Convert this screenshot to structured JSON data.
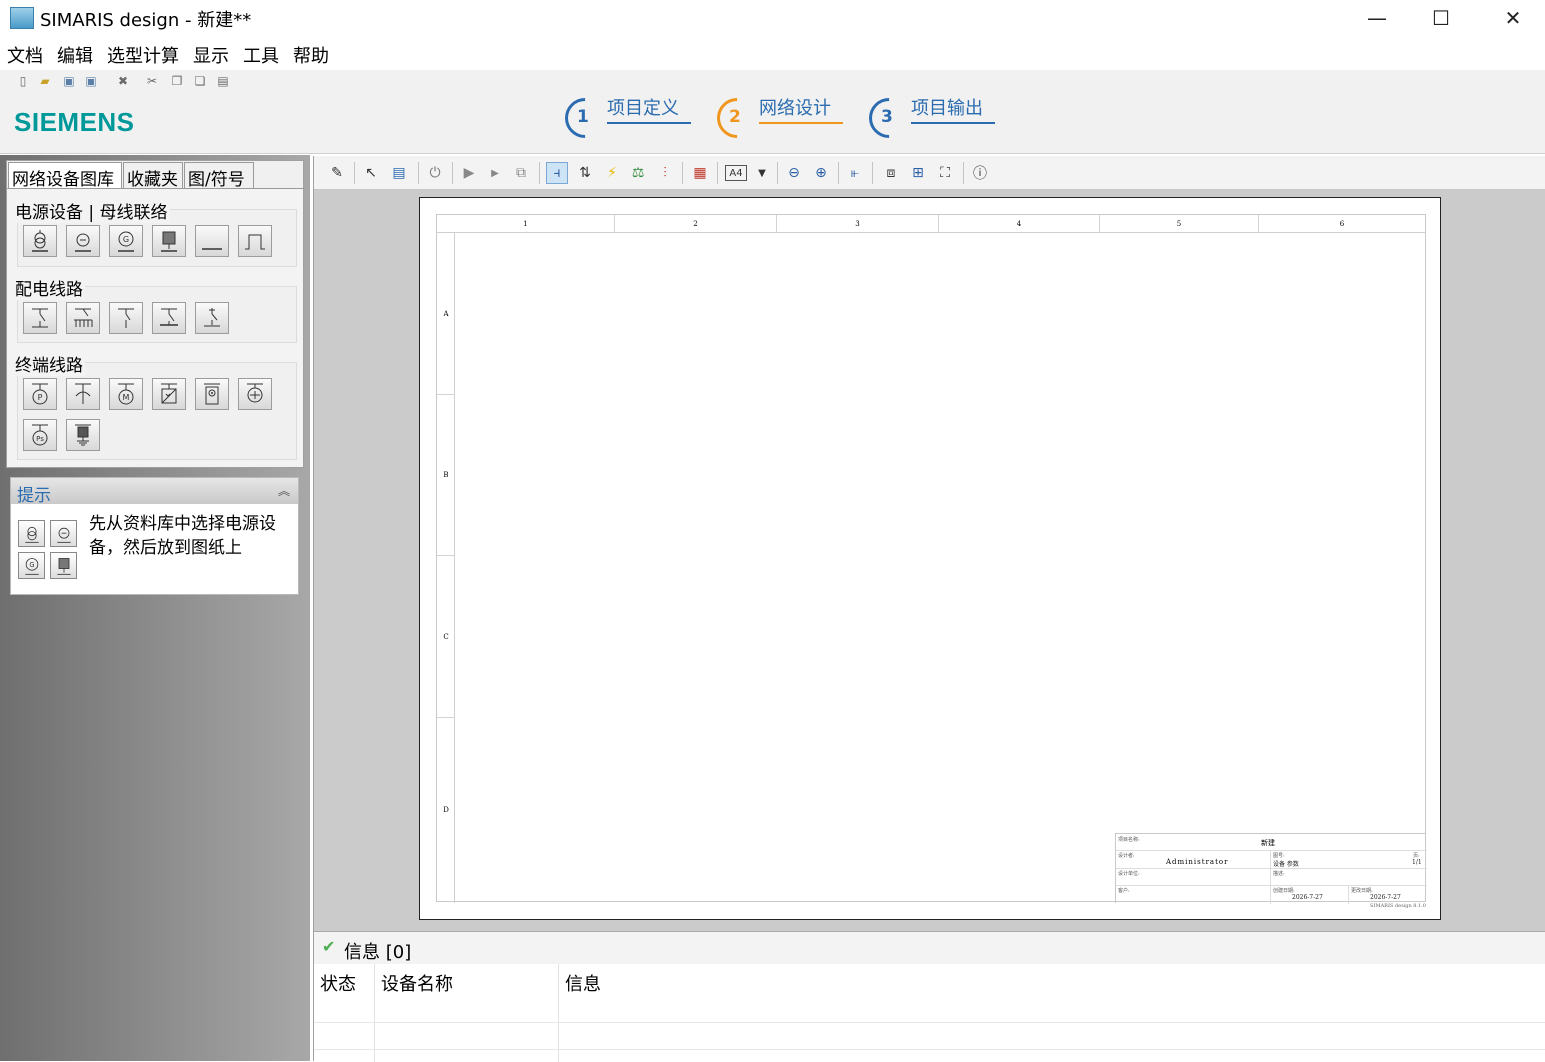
{
  "window": {
    "title": "SIMARIS design - 新建**",
    "minimize": "—",
    "maximize": "☐",
    "close": "✕"
  },
  "menu": [
    "文档",
    "编辑",
    "选型计算",
    "显示",
    "工具",
    "帮助"
  ],
  "brand": "SIEMENS",
  "steps": [
    {
      "num": "1",
      "label": "项目定义",
      "active": false
    },
    {
      "num": "2",
      "label": "网络设计",
      "active": true
    },
    {
      "num": "3",
      "label": "项目输出",
      "active": false
    }
  ],
  "library": {
    "tabs": [
      "网络设备图库",
      "收藏夹",
      "图/符号"
    ],
    "groups": [
      {
        "title": "电源设备 | 母线联络",
        "symbols": [
          "transformer-icon",
          "transformer-alt-icon",
          "generator-icon",
          "ups-icon",
          "busbar-icon",
          "coupler-icon"
        ]
      },
      {
        "title": "配电线路",
        "symbols": [
          "distribution-icon",
          "busway-icon",
          "cable-feeder-icon",
          "sub-distribution-icon",
          "switch-feeder-icon"
        ]
      },
      {
        "title": "终端线路",
        "symbols": [
          "load-p-icon",
          "load-icon",
          "motor-icon",
          "capacitor-icon",
          "charger-icon",
          "equipment-icon",
          "load-ps-icon",
          "ground-load-icon"
        ]
      }
    ]
  },
  "hint": {
    "title": "提示",
    "text": "先从资料库中选择电源设备，然后放到图纸上"
  },
  "drawing": {
    "columns": [
      "1",
      "2",
      "3",
      "4",
      "5",
      "6"
    ],
    "rows": [
      "A",
      "B",
      "C",
      "D"
    ],
    "title_block": {
      "project_label": "项目名称:",
      "project_value": "新建",
      "designer_label": "设计者:",
      "designer_value": "Administrator",
      "unit_label": "设计单位:",
      "drawing_label": "图号:",
      "drawing_value": "设备 参数",
      "sheet_label": "页:",
      "sheet_value": "1/1",
      "remark_label": "描述:",
      "client_label": "客户:",
      "created_label": "创建日期:",
      "created_value": "2026-7-27",
      "modified_label": "更改日期:",
      "modified_value": "2026-7-27"
    },
    "footer": "SIMARIS design 8.1.0"
  },
  "info": {
    "title": "信息 [0]",
    "columns": [
      "状态",
      "设备名称",
      "信息"
    ]
  }
}
